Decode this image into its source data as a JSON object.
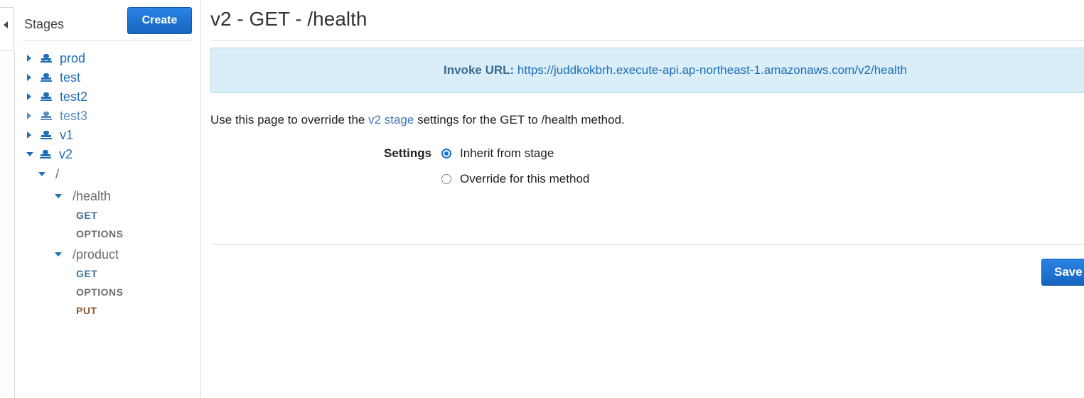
{
  "sidebar": {
    "title": "Stages",
    "create_label": "Create",
    "stages": [
      {
        "label": "prod"
      },
      {
        "label": "test"
      },
      {
        "label": "test2"
      },
      {
        "label": "test3"
      },
      {
        "label": "v1"
      },
      {
        "label": "v2"
      }
    ],
    "resources": {
      "root": "/",
      "health": {
        "label": "/health",
        "methods": [
          "GET",
          "OPTIONS"
        ]
      },
      "product": {
        "label": "/product",
        "methods": [
          "GET",
          "OPTIONS",
          "PUT"
        ]
      }
    }
  },
  "main": {
    "title": "v2 - GET - /health",
    "invoke_label": "Invoke URL:",
    "invoke_url": "https://juddkokbrh.execute-api.ap-northeast-1.amazonaws.com/v2/health",
    "desc_before": "Use this page to override the ",
    "desc_link": "v2 stage",
    "desc_after": " settings for the GET to /health method.",
    "settings_label": "Settings",
    "options": [
      {
        "label": "Inherit from stage",
        "checked": true
      },
      {
        "label": "Override for this method",
        "checked": false
      }
    ],
    "save_label": "Save"
  },
  "colors": {
    "primary": "#1a6fd1",
    "link": "#1f6eb8",
    "info_bg": "#d9eef8"
  },
  "icons": {
    "stage": "stage-icon",
    "collapse": "caret-left-icon",
    "expand": "caret-right-icon",
    "expanded": "caret-down-icon"
  }
}
